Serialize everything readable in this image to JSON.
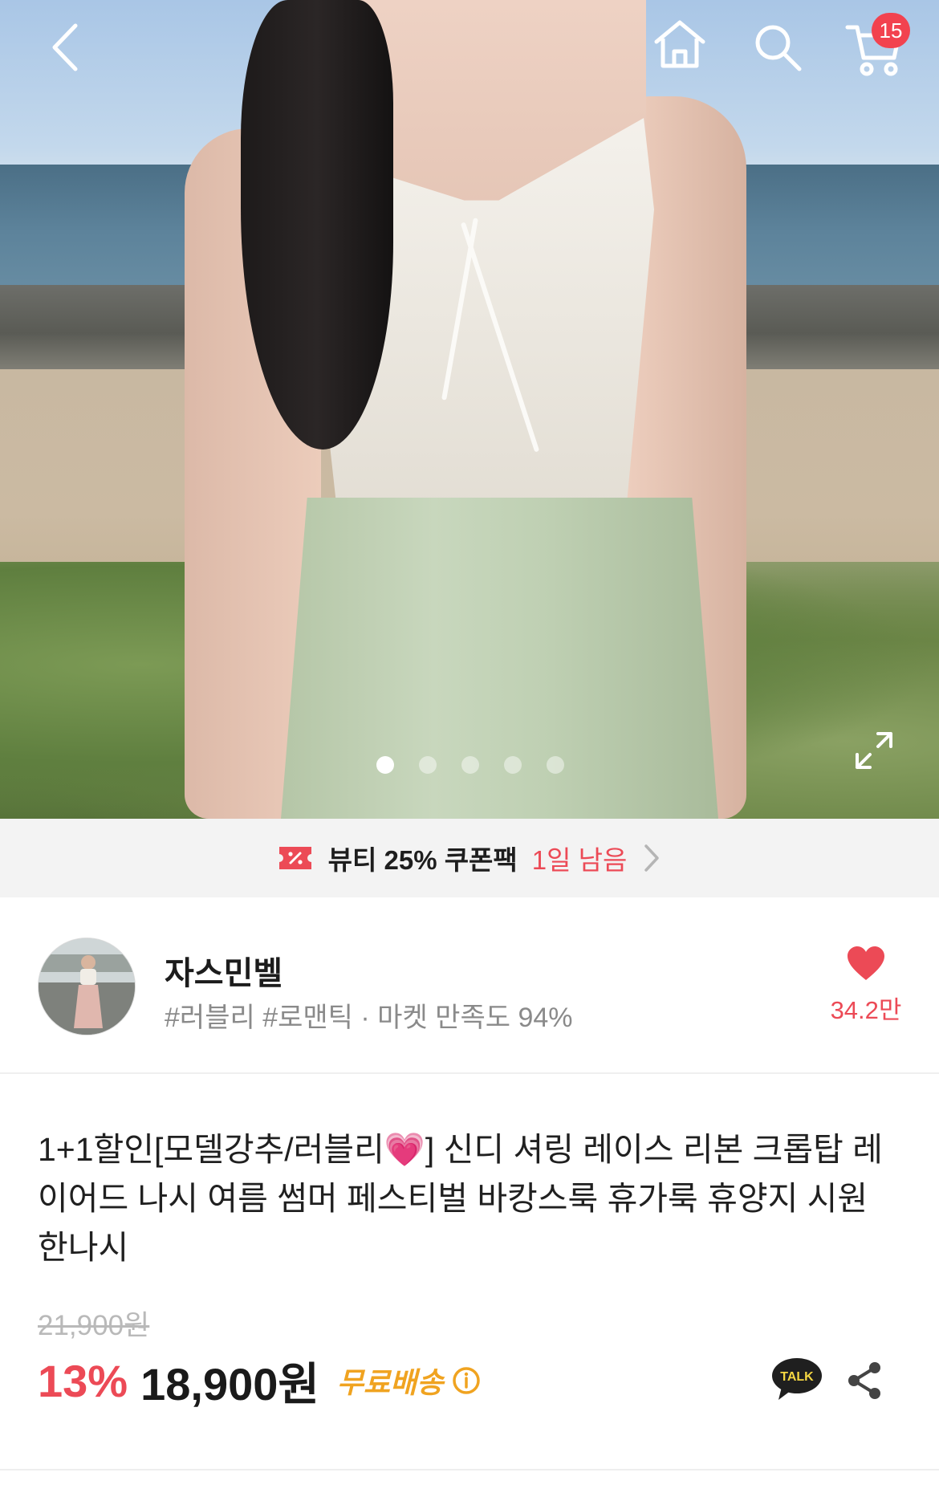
{
  "header": {
    "cart_count": "15",
    "icons": [
      "back-icon",
      "home-icon",
      "search-icon",
      "cart-icon",
      "fullscreen-icon"
    ]
  },
  "gallery": {
    "total_images": 5,
    "active_index": 0
  },
  "coupon_bar": {
    "text": "뷰티 25% 쿠폰팩",
    "remaining": "1일 남음"
  },
  "seller": {
    "name": "자스민벨",
    "tags": "#러블리 #로맨틱 · 마켓 만족도 94%",
    "like_count": "34.2만"
  },
  "product": {
    "title": "1+1할인[모델강추/러블리💗] 신디 셔링 레이스 리본 크롭탑 레이어드 나시 여름 썸머 페스티벌 바캉스룩 휴가룩 휴양지 시원한나시",
    "original_price": "21,900원",
    "discount": "13%",
    "price": "18,900원",
    "shipping": "무료배송"
  },
  "actions": {
    "talk_label": "TALK"
  },
  "colors": {
    "accent": "#ec4a56",
    "shipping": "#f0a320"
  }
}
